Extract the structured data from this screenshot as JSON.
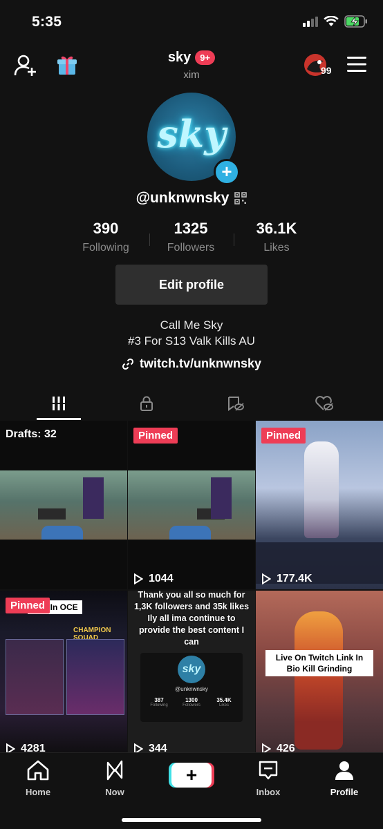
{
  "status_bar": {
    "time": "5:35"
  },
  "header": {
    "display_name": "sky",
    "notification_badge": "9+",
    "secondary_name": "xim",
    "coin_count": "99"
  },
  "profile": {
    "avatar_text": "sky",
    "username": "@unknwnsky",
    "stats": [
      {
        "value": "390",
        "label": "Following"
      },
      {
        "value": "1325",
        "label": "Followers"
      },
      {
        "value": "36.1K",
        "label": "Likes"
      }
    ],
    "edit_button": "Edit profile",
    "bio_line1": "Call Me Sky",
    "bio_line2": "#3 For S13 Valk Kills AU",
    "link": "twitch.tv/unknwnsky"
  },
  "tabs": [
    {
      "icon": "grid-icon"
    },
    {
      "icon": "lock-icon"
    },
    {
      "icon": "hidden-bookmark-icon"
    },
    {
      "icon": "liked-icon"
    }
  ],
  "videos": {
    "pinned_label": "Pinned",
    "drafts_label": "Drafts: 32",
    "items": [
      {
        "views": ""
      },
      {
        "views": "1044"
      },
      {
        "views": "177.4K"
      },
      {
        "views": "4281",
        "caption": "Duo In OCE",
        "overlay_heading": "CHAMPION SQUAD"
      },
      {
        "views": "344",
        "caption": "Thank you all so much for 1,3K followers and 35k likes Ily all ima continue to provide the best content I can",
        "mini_profile": {
          "avatar_text": "sky",
          "username": "@unknwnsky",
          "stats": [
            {
              "value": "387",
              "label": "Following"
            },
            {
              "value": "1300",
              "label": "Followers"
            },
            {
              "value": "35.4K",
              "label": "Likes"
            }
          ]
        }
      },
      {
        "views": "426",
        "caption": "Live On Twitch Link In Bio Kill Grinding"
      }
    ]
  },
  "bottom_nav": [
    {
      "label": "Home"
    },
    {
      "label": "Now"
    },
    {
      "label": "+"
    },
    {
      "label": "Inbox"
    },
    {
      "label": "Profile"
    }
  ],
  "colors": {
    "background": "#121212",
    "accent_red": "#ee3d56",
    "accent_cyan": "#3fe0e6",
    "avatar_blue": "#2e80a6"
  }
}
